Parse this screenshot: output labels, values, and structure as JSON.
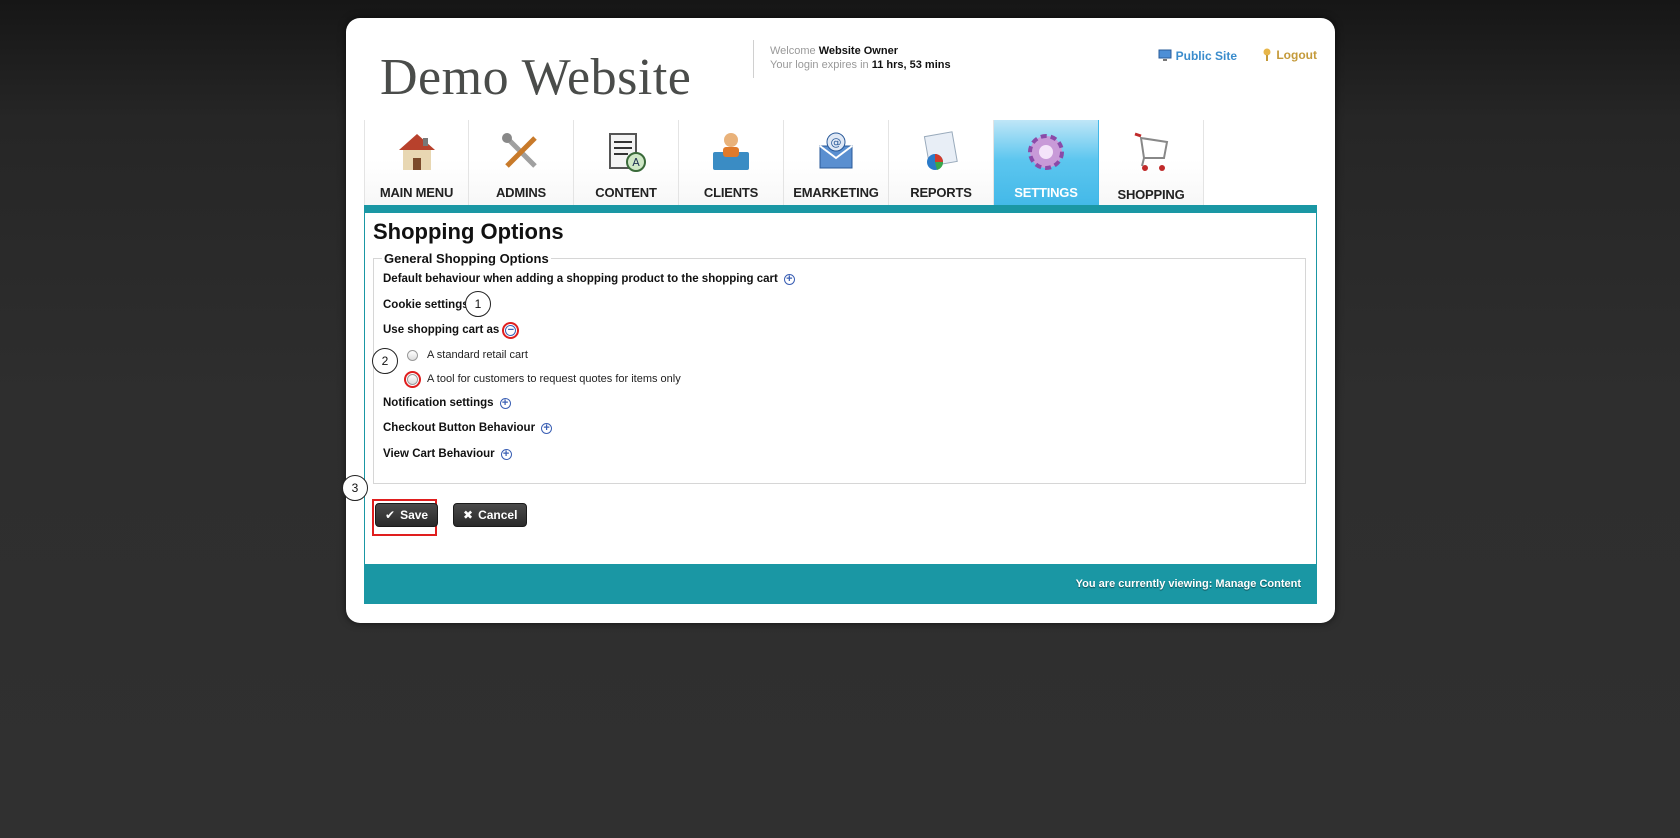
{
  "header": {
    "site_title": "Demo Website",
    "welcome_prefix": "Welcome",
    "user_name": "Website Owner",
    "login_prefix": "Your login expires in",
    "login_time": "11 hrs, 53 mins",
    "public_site": "Public Site",
    "logout": "Logout"
  },
  "nav": {
    "tabs": [
      {
        "label": "MAIN MENU",
        "icon": "house-icon"
      },
      {
        "label": "ADMINS",
        "icon": "tools-icon"
      },
      {
        "label": "CONTENT",
        "icon": "document-icon"
      },
      {
        "label": "CLIENTS",
        "icon": "person-folder-icon"
      },
      {
        "label": "EMARKETING",
        "icon": "email-icon"
      },
      {
        "label": "REPORTS",
        "icon": "report-chart-icon"
      },
      {
        "label": "SETTINGS",
        "icon": "gear-icon"
      },
      {
        "label": "SHOPPING",
        "icon": "shopping-cart-icon"
      }
    ],
    "active": "SETTINGS"
  },
  "main": {
    "title": "Shopping Options",
    "section_legend": "General Shopping Options",
    "rows": {
      "default_behaviour": "Default behaviour when adding a shopping product to the shopping cart",
      "cookie_settings": "Cookie settings",
      "use_cart_as": "Use shopping cart as",
      "notification": "Notification settings",
      "checkout": "Checkout Button Behaviour",
      "view_cart": "View Cart Behaviour"
    },
    "options": {
      "standard": "A standard retail cart",
      "quotes": "A tool for customers to request quotes for items only"
    },
    "expand_symbol": "+",
    "collapse_symbol": "−"
  },
  "callouts": {
    "one": "1",
    "two": "2",
    "three": "3"
  },
  "buttons": {
    "save": "Save",
    "cancel": "Cancel",
    "save_icon": "✔",
    "cancel_icon": "✖"
  },
  "footer": {
    "viewing": "You are currently viewing: Manage Content"
  },
  "colors": {
    "teal": "#1a97a4",
    "active_tab": "#42b8e8",
    "highlight": "#e01e1e"
  }
}
